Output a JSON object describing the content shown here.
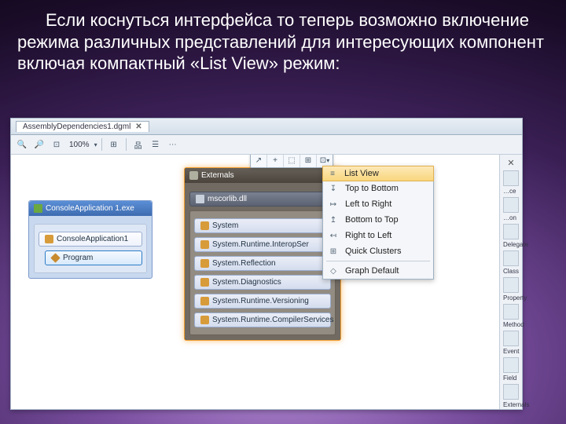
{
  "slide_text": "Если коснуться интерфейса то теперь возможно включение режима различных представлений для интересующих компонент включая компактный «List View» режим:",
  "tab": {
    "title": "AssemblyDependencies1.dgml",
    "close": "✕"
  },
  "toolbar": {
    "zoom": "100%",
    "dropdown": "▾"
  },
  "float_buttons": [
    "↗",
    "+",
    "⬚",
    "⊞",
    "⊡"
  ],
  "left_group": {
    "title": "ConsoleApplication 1.exe",
    "ns": "ConsoleApplication1",
    "cls": "Program"
  },
  "right_group": {
    "title": "Externals",
    "asm": "mscorlib.dll",
    "items": [
      "System",
      "System.Runtime.InteropSer",
      "System.Reflection",
      "System.Diagnostics",
      "System.Runtime.Versioning",
      "System.Runtime.CompilerServices"
    ]
  },
  "menu": [
    "List View",
    "Top to Bottom",
    "Left to Right",
    "Bottom to Top",
    "Right to Left",
    "Quick Clusters",
    "Graph Default"
  ],
  "menu_icons": [
    "≡",
    "↧",
    "↦",
    "↥",
    "↤",
    "⊞",
    "◇"
  ],
  "legend": {
    "x": "✕",
    "items": [
      "…ce",
      "…on",
      "Delegate",
      "Class",
      "Property",
      "Method",
      "Event",
      "Field",
      "Externals"
    ]
  }
}
